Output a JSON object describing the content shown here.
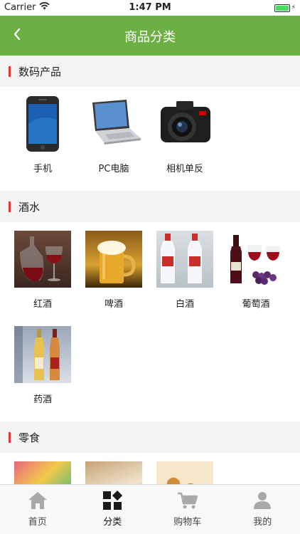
{
  "status_bar": {
    "carrier": "Carrier",
    "time": "1:47 PM",
    "battery_color": "#4cd964"
  },
  "nav": {
    "title": "商品分类",
    "back_icon": "chevron-left-icon",
    "background": "#6cb043"
  },
  "sections": [
    {
      "title": "数码产品",
      "items": [
        {
          "label": "手机",
          "icon": "phone-image"
        },
        {
          "label": "PC电脑",
          "icon": "laptop-image"
        },
        {
          "label": "相机单反",
          "icon": "camera-image"
        }
      ]
    },
    {
      "title": "酒水",
      "items": [
        {
          "label": "红酒",
          "icon": "red-wine-image"
        },
        {
          "label": "啤酒",
          "icon": "beer-image"
        },
        {
          "label": "白酒",
          "icon": "baijiu-image"
        },
        {
          "label": "葡萄酒",
          "icon": "grape-wine-image"
        },
        {
          "label": "药酒",
          "icon": "medicinal-wine-image"
        }
      ]
    },
    {
      "title": "零食",
      "items": [
        {
          "icon": "candy-image"
        },
        {
          "icon": "cake-image"
        },
        {
          "icon": "cookies-image"
        }
      ]
    }
  ],
  "tabs": [
    {
      "label": "首页",
      "icon": "home-icon"
    },
    {
      "label": "分类",
      "icon": "category-icon",
      "active": true
    },
    {
      "label": "购物车",
      "icon": "cart-icon"
    },
    {
      "label": "我的",
      "icon": "user-icon"
    }
  ],
  "accent_colors": {
    "section_bar": "#e0393e",
    "tab_icon_inactive": "#a9a9a9",
    "tab_icon_active": "#1a1a1a"
  }
}
